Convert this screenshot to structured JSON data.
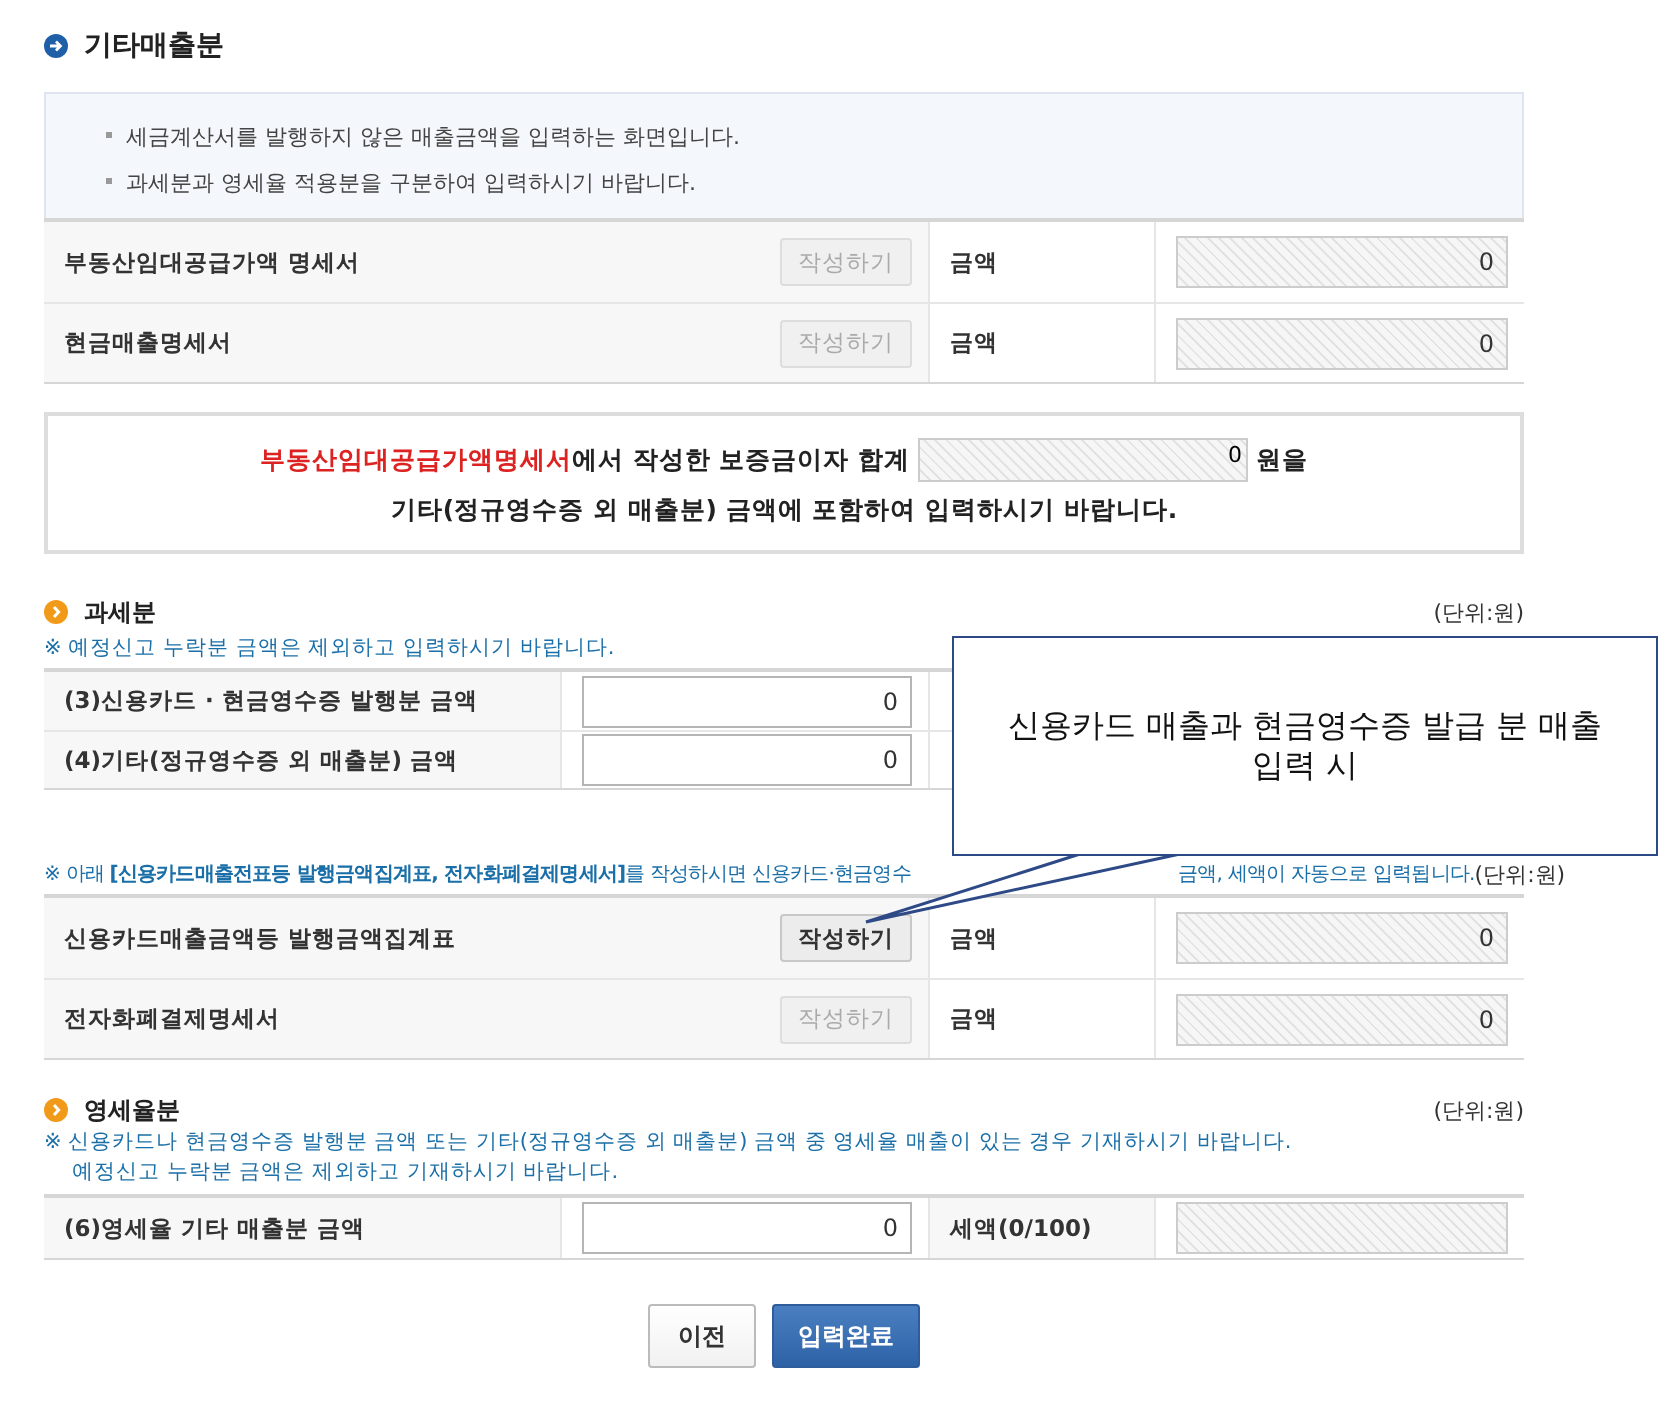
{
  "section_title": "기타매출분",
  "info": [
    "세금계산서를 발행하지 않은 매출금액을 입력하는 화면입니다.",
    "과세분과 영세율 적용분을 구분하여 입력하시기 바랍니다."
  ],
  "statements": [
    {
      "label": "부동산임대공급가액 명세서",
      "button": "작성하기",
      "disabled": true,
      "amount_label": "금액",
      "amount": "0"
    },
    {
      "label": "현금매출명세서",
      "button": "작성하기",
      "disabled": true,
      "amount_label": "금액",
      "amount": "0"
    }
  ],
  "deposit_notice": {
    "highlight": "부동산임대공급가액명세서",
    "text_1": "에서 작성한 보증금이자 합계",
    "value": "0",
    "text_2": "원을",
    "line_2": "기타(정규영수증 외 매출분) 금액에 포함하여 입력하시기 바랍니다."
  },
  "taxable": {
    "title": "과세분",
    "unit": "(단위:원)",
    "note": "※ 예정신고 누락분 금액은 제외하고 입력하시기 바랍니다.",
    "rows": [
      {
        "label": "(3)신용카드 · 현금영수증 발행분 금액",
        "value": "0"
      },
      {
        "label": "(4)기타(정규영수증 외 매출분) 금액",
        "value": "0"
      }
    ]
  },
  "auto_notice": {
    "part_1": "※ 아래 **[신용카드매출전표등 발행금액집계표, 전자화폐결제명세서]**를 작성하시면 신용카드·현금영수",
    "part_2": "금액, 세액이 자동으로 입력됩니다.",
    "unit": "(단위:원)"
  },
  "auto_statements": [
    {
      "label": "신용카드매출금액등 발행금액집계표",
      "button": "작성하기",
      "disabled": false,
      "amount_label": "금액",
      "amount": "0"
    },
    {
      "label": "전자화폐결제명세서",
      "button": "작성하기",
      "disabled": true,
      "amount_label": "금액",
      "amount": "0"
    }
  ],
  "zero_rated": {
    "title": "영세율분",
    "unit": "(단위:원)",
    "notes": [
      "※ 신용카드나 현금영수증 발행분 금액 또는 기타(정규영수증 외 매출분) 금액 중 영세율 매출이 있는 경우 기재하시기 바랍니다.",
      "예정신고 누락분 금액은 제외하고 기재하시기 바랍니다."
    ],
    "row": {
      "label": "(6)영세율 기타 매출분 금액",
      "value": "0",
      "tax_label": "세액(0/100)"
    }
  },
  "buttons": [
    {
      "label": "이전",
      "kind": "secondary"
    },
    {
      "label": "입력완료",
      "kind": "primary"
    }
  ],
  "callout": {
    "text": "신용카드 매출과 현금영수증 발급 분 매출 입력 시"
  }
}
